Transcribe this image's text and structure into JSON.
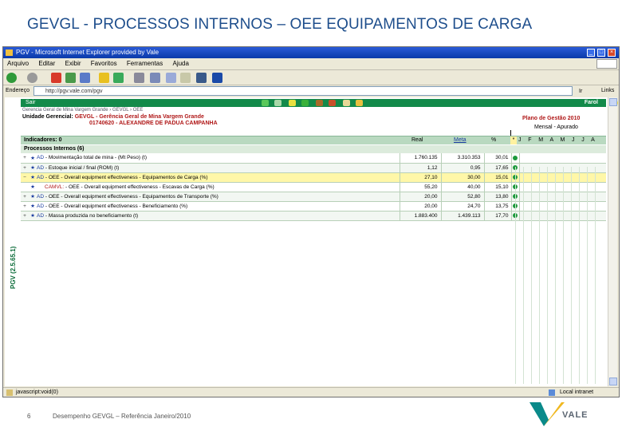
{
  "slide": {
    "title": "GEVGL - PROCESSOS INTERNOS – OEE EQUIPAMENTOS DE CARGA",
    "page_number": "6",
    "footer_text": "Desempenho GEVGL – Referência Janeiro/2010",
    "logo_text": "VALE"
  },
  "browser": {
    "title": "PGV - Microsoft Internet Explorer provided by Vale",
    "menu": [
      "Arquivo",
      "Editar",
      "Exibir",
      "Favoritos",
      "Ferramentas",
      "Ajuda"
    ],
    "address_label": "Endereço",
    "address_value": "http://pgv.vale.com/pgv",
    "go_label": "Ir",
    "links_label": "Links",
    "status_left": "javascript:void(0)",
    "status_right": "Local intranet"
  },
  "app": {
    "header_left": "Sair",
    "header_right": "Farol",
    "side_label": "PGV (2.5.65.1)",
    "breadcrumb": "Gerencia Geral de Mina Vargem Grande › GEVGL › OEE",
    "unit_label": "Unidade Gerencial:",
    "unit_code": "GEVGL",
    "unit_name": " - Gerência Geral de Mina Vargem Grande",
    "manager": "01740620 - ALEXANDRE DE PADUA CAMPANHA",
    "plan": "Plano de Gestão 2010",
    "period": "Mensal - Apurado",
    "indicators_label": "Indicadores: 0",
    "col_real": "Real",
    "col_meta": "Meta",
    "col_pct": "%",
    "star": "*",
    "months": "J F M A M J J A S O N D",
    "processes_label": "Processos Internos (6)"
  },
  "rows": [
    {
      "exp": "+",
      "code": "AD",
      "name": "Movimentação total de mina - (Mt Peso) (t)",
      "real": "1.760.135",
      "meta": "3.310.353",
      "pct": "30,01",
      "style": "normal"
    },
    {
      "exp": "+",
      "code": "AD",
      "name": "Estoque inicial / final (ROM) (t)",
      "real": "1,12",
      "meta": "0,95",
      "pct": "17,65",
      "style": "alt"
    },
    {
      "exp": "−",
      "code": "AD",
      "name": "OEE - Overall equipment effectiveness - Equipamentos de Carga (%)",
      "real": "27,10",
      "meta": "30,00",
      "pct": "15,01",
      "style": "hl"
    },
    {
      "exp": "",
      "code": "CAMVL:",
      "name": "OEE - Overall equipment effectiveness - Escavas de Carga (%)",
      "real": "55,20",
      "meta": "40,00",
      "pct": "15,10",
      "style": "normal",
      "indent": true
    },
    {
      "exp": "+",
      "code": "AD",
      "name": "OEE - Overall equipment effectiveness - Equipamentos de Transporte (%)",
      "real": "20,00",
      "meta": "52,80",
      "pct": "13,80",
      "style": "alt"
    },
    {
      "exp": "+",
      "code": "AD",
      "name": "OEE - Overall equipment effectiveness - Beneficiamento (%)",
      "real": "20,00",
      "meta": "24,70",
      "pct": "13,75",
      "style": "normal"
    },
    {
      "exp": "+",
      "code": "AD",
      "name": "Massa produzida no beneficiamento (t)",
      "real": "1.883.400",
      "meta": "1.439.113",
      "pct": "17,70",
      "style": "alt"
    }
  ]
}
